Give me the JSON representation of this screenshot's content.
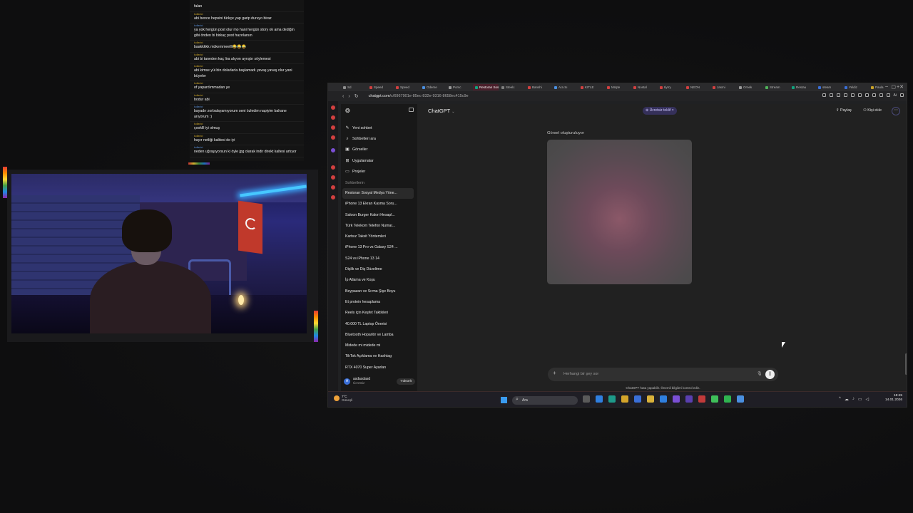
{
  "chat": {
    "messages": [
      {
        "user": "",
        "text": "falan",
        "user_color": "gold"
      },
      {
        "user": "kullanici",
        "text": "abi bence hepsini türkçe yap garip duruyo biraz",
        "user_color": "gold"
      },
      {
        "user": "kullanici",
        "text": "ya yok hergün post olur mo hani hergün story ok ama dediğin gibi önden bi birkaç post hazırlarsın",
        "user_color": "blue"
      },
      {
        "user": "kullanici",
        "text": "baakkkkk mükemmeelll😂😂😂",
        "user_color": "gold"
      },
      {
        "user": "kullanici",
        "text": "abi bi taneden kaç lira alıyon ayrıştır söylemesi",
        "user_color": "gold"
      },
      {
        "user": "kullanici",
        "text": "abi kimse yüi bin dolarlarla başlamadı yavaş yavaş olur yani büyeler",
        "user_color": "gold"
      },
      {
        "user": "kullanici",
        "text": "of yapardımmadan ye",
        "user_color": "gold"
      },
      {
        "user": "kullanici",
        "text": "bodur abi",
        "user_color": "gold"
      },
      {
        "user": "kullanici",
        "text": "bayadır zorbalayamıyorum seni özledim napiyim bahane arıyorum :)",
        "user_color": "blue"
      },
      {
        "user": "kullanici",
        "text": "çooklll iyi olmuş",
        "user_color": "gold"
      },
      {
        "user": "kullanici",
        "text": "hayır netliği kalitesi de iyi",
        "user_color": "gold"
      },
      {
        "user": "kullanici",
        "text": "neden uğraşıyorsun ki öyle jpg olarak indir direkt kaltesi artıyor",
        "user_color": "blue"
      }
    ]
  },
  "browser": {
    "tabs": [
      {
        "label": "Sd",
        "color": "#8e8e8e"
      },
      {
        "label": "Speed",
        "color": "#d24040"
      },
      {
        "label": "Speed",
        "color": "#d24040"
      },
      {
        "label": "Odeme",
        "color": "#4a8fe0"
      },
      {
        "label": "Porsc",
        "color": "#999999"
      },
      {
        "label": "Restoran Sos",
        "color": "#10a37f",
        "active": true
      },
      {
        "label": "Steelc",
        "color": "#7f7f7f"
      },
      {
        "label": "Banshi",
        "color": "#d24040"
      },
      {
        "label": "Ara Sı",
        "color": "#4a8fe0"
      },
      {
        "label": "KITLE",
        "color": "#d24040"
      },
      {
        "label": "Müşte",
        "color": "#d24040"
      },
      {
        "label": "Nostal",
        "color": "#d24040"
      },
      {
        "label": "Ilyrry",
        "color": "#d24040"
      },
      {
        "label": "NEON",
        "color": "#d24040"
      },
      {
        "label": "Jasmi",
        "color": "#d24040"
      },
      {
        "label": "Ornek",
        "color": "#999999"
      },
      {
        "label": "Stream",
        "color": "#4fb35a"
      },
      {
        "label": "Restau",
        "color": "#10a37f"
      },
      {
        "label": "steam",
        "color": "#3a6fd8"
      },
      {
        "label": "Yeldiz",
        "color": "#3a6fd8"
      },
      {
        "label": "Paula",
        "color": "#c9a227"
      }
    ],
    "url_host": "chatgpt.com",
    "url_path": "/c/6967901e-85ec-832e-9316-8658ec415c9e",
    "ext_ai": "Ai"
  },
  "sidebar": {
    "nav": [
      {
        "icon": "✎",
        "icon_name": "new-chat-icon",
        "label": "Yeni sohbet"
      },
      {
        "icon": "⌕",
        "icon_name": "search-icon",
        "label": "Sohbetleri ara"
      },
      {
        "icon": "▣",
        "icon_name": "images-icon",
        "label": "Görseller"
      },
      {
        "icon": "⊞",
        "icon_name": "apps-icon",
        "label": "Uygulamalar"
      },
      {
        "icon": "▭",
        "icon_name": "folder-icon",
        "label": "Projeler"
      }
    ],
    "section_title": "Sohbetlerin",
    "conversations": [
      "Restoran Sosyal Medya Yöne...",
      "iPhone 13 Ekran Kasma Soru...",
      "Saloon Burger Kalori Hesapl...",
      "Türk Telekom Telefon Numar...",
      "Kartsız Taksit Yöntemleri",
      "iPhone 13 Pro vs Galaxy S24 ...",
      "S24 vs iPhone 13 14",
      "Dişlik ve Diş Düzeltme",
      "İp Atlama ve Koşu",
      "Beypazarı ve Sırma Şişe Boyu",
      "Et protein hesaplama",
      "Reels için Keşfet Taktikleri",
      "40.000 TL Laptop Önerisi",
      "Bluetooth Hoparlör ve Lamba",
      "Midede mi midede mi",
      "TikTok Açıklama ve Hashtag",
      "RTX 4070 Super Ayarları"
    ],
    "user": {
      "initial": "A",
      "name": "asdasdasd",
      "plan": "Ücretsiz",
      "upgrade": "Yükselt"
    }
  },
  "main": {
    "model": "ChatGPT",
    "offer": "Ücretsiz teklif",
    "share": "Paylaş",
    "add_person": "Kişi ekle",
    "generating_label": "Görsel oluşturuluyor",
    "composer_placeholder": "Herhangi bir şey sor",
    "disclaimer": "ChatGPT hata yapabilir. Önemli bilgileri kontrol edin."
  },
  "taskbar": {
    "temp": "7°C",
    "condition": "Güneşli",
    "search": "Ara",
    "time": "18:45",
    "date": "14.01.2026",
    "apps": [
      "#5a5a5a",
      "#2f7fe0",
      "#1e9a8a",
      "#d4a42a",
      "#3a6fd8",
      "#d9b13a",
      "#2f7fe0",
      "#7b4fd6",
      "#5a3fb0",
      "#c23a3a",
      "#3fbf5a",
      "#2fb350",
      "#4a8fe0"
    ]
  }
}
